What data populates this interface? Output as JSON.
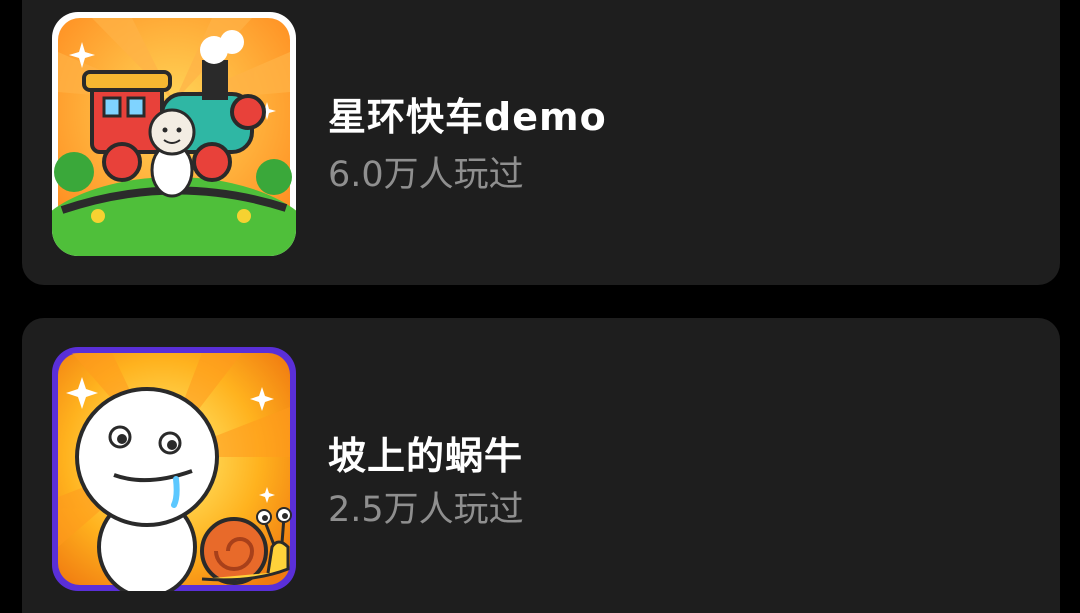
{
  "games": [
    {
      "title": "星环快车demo",
      "plays": "6.0万人玩过",
      "icon": "train-game-icon"
    },
    {
      "title": "坡上的蜗牛",
      "plays": "2.5万人玩过",
      "icon": "snail-game-icon"
    }
  ],
  "colors": {
    "background": "#000000",
    "card": "#1e1e1e",
    "title": "#ffffff",
    "subtitle": "#8f8f8f"
  }
}
